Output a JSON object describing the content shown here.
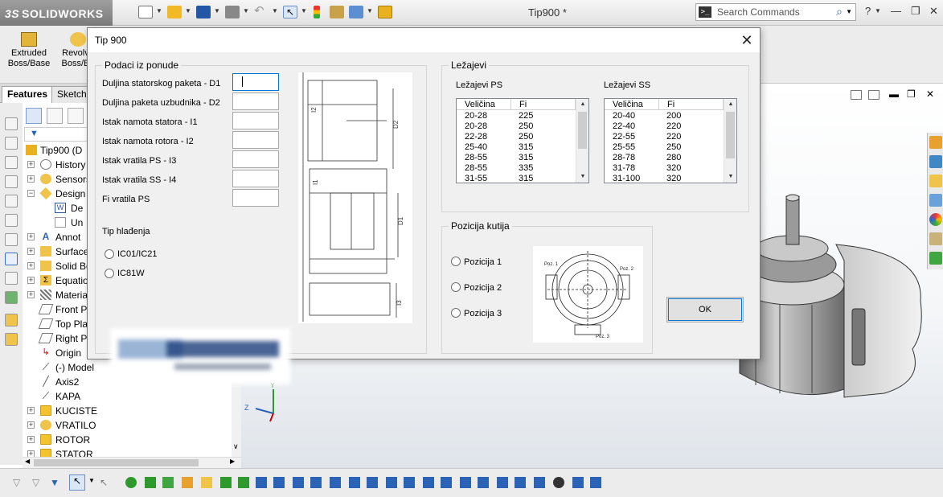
{
  "app": {
    "logo_text": "SOLIDWORKS",
    "logo_prefix": "3S",
    "doc_title": "Tip900 *",
    "search_placeholder": "Search Commands",
    "search_cmd_glyph": ">_",
    "help_glyph": "?",
    "window_min": "—",
    "window_restore": "❐",
    "window_close": "✕"
  },
  "command_manager": {
    "items": [
      {
        "label_line1": "Extruded",
        "label_line2": "Boss/Base"
      },
      {
        "label_line1": "Revolve",
        "label_line2": "Boss/Ba"
      }
    ]
  },
  "feature_manager": {
    "tabs": [
      "Features",
      "Sketch"
    ],
    "tree": [
      {
        "label": "Tip900  (D",
        "icon": "part-icon",
        "expand": ""
      },
      {
        "label": "History",
        "icon": "history-icon",
        "expand": "+"
      },
      {
        "label": "Sensors",
        "icon": "sensor-icon",
        "expand": "+"
      },
      {
        "label": "Design",
        "icon": "design-binder-icon",
        "expand": "−"
      },
      {
        "label": "De",
        "icon": "word-doc-icon",
        "expand": ""
      },
      {
        "label": "Un",
        "icon": "unknown-doc-icon",
        "expand": ""
      },
      {
        "label": "Annot",
        "icon": "annotations-icon",
        "expand": "+"
      },
      {
        "label": "Surface",
        "icon": "surface-bodies-icon",
        "expand": "+"
      },
      {
        "label": "Solid Bo",
        "icon": "solid-bodies-icon",
        "expand": "+"
      },
      {
        "label": "Equatio",
        "icon": "equations-icon",
        "expand": "+"
      },
      {
        "label": "Materia",
        "icon": "material-icon",
        "expand": "+"
      },
      {
        "label": "Front P",
        "icon": "plane-icon",
        "expand": ""
      },
      {
        "label": "Top Pla",
        "icon": "plane-icon",
        "expand": ""
      },
      {
        "label": "Right P",
        "icon": "plane-icon",
        "expand": ""
      },
      {
        "label": "Origin",
        "icon": "origin-icon",
        "expand": ""
      },
      {
        "label": "(-) Model",
        "icon": "sketch-icon",
        "expand": ""
      },
      {
        "label": "Axis2",
        "icon": "axis-icon",
        "expand": ""
      },
      {
        "label": "KAPA",
        "icon": "sketch-icon",
        "expand": ""
      },
      {
        "label": "KUCISTE",
        "icon": "folder-icon",
        "expand": "+"
      },
      {
        "label": "VRATILO",
        "icon": "revolve-feature-icon",
        "expand": "+"
      },
      {
        "label": "ROTOR",
        "icon": "folder-icon",
        "expand": "+"
      },
      {
        "label": "STATOR",
        "icon": "folder-icon",
        "expand": "+"
      }
    ]
  },
  "dialog": {
    "title": "Tip 900",
    "close_glyph": "✕",
    "offer_group": {
      "title": "Podaci iz ponude",
      "fields": [
        {
          "label": "Duljina statorskog paketa - D1",
          "value": ""
        },
        {
          "label": "Duljina paketa uzbudnika - D2",
          "value": ""
        },
        {
          "label": "Istak namota statora - I1",
          "value": ""
        },
        {
          "label": "Istak namota rotora - I2",
          "value": ""
        },
        {
          "label": "Istak vratila PS - I3",
          "value": ""
        },
        {
          "label": "Istak vratila SS - I4",
          "value": ""
        },
        {
          "label": "Fi vratila PS",
          "value": ""
        }
      ],
      "cooling_label": "Tip hlađenja",
      "cooling_options": [
        "IC01/IC21",
        "IC81W"
      ]
    },
    "drawing_labels": {
      "i2": "I2",
      "d2": "D2",
      "i1": "I1",
      "d1": "D1",
      "i3": "I3"
    },
    "bearings_group": {
      "title": "Ležajevi",
      "ps": {
        "label": "Ležajevi PS",
        "headers": [
          "Veličina",
          "Fi"
        ],
        "rows": [
          [
            "20-28",
            "225"
          ],
          [
            "20-28",
            "250"
          ],
          [
            "22-28",
            "250"
          ],
          [
            "25-40",
            "315"
          ],
          [
            "28-55",
            "315"
          ],
          [
            "28-55",
            "335"
          ],
          [
            "31-55",
            "315"
          ]
        ]
      },
      "ss": {
        "label": "Ležajevi SS",
        "headers": [
          "Veličina",
          "Fi"
        ],
        "rows": [
          [
            "20-40",
            "200"
          ],
          [
            "22-40",
            "220"
          ],
          [
            "22-55",
            "220"
          ],
          [
            "25-55",
            "250"
          ],
          [
            "28-78",
            "280"
          ],
          [
            "31-78",
            "320"
          ],
          [
            "31-100",
            "320"
          ]
        ]
      }
    },
    "box_group": {
      "title": "Pozicija kutija",
      "options": [
        "Pozicija 1",
        "Pozicija 2",
        "Pozicija 3"
      ],
      "diagram_labels": [
        "Poz. 1",
        "Poz. 2",
        "Poz. 3"
      ]
    },
    "ok_label": "OK"
  },
  "colors": {
    "accent": "#0078d7",
    "folder": "#f4c430",
    "green_icon": "#2e9a2e",
    "blue_icon": "#2a63b5"
  }
}
